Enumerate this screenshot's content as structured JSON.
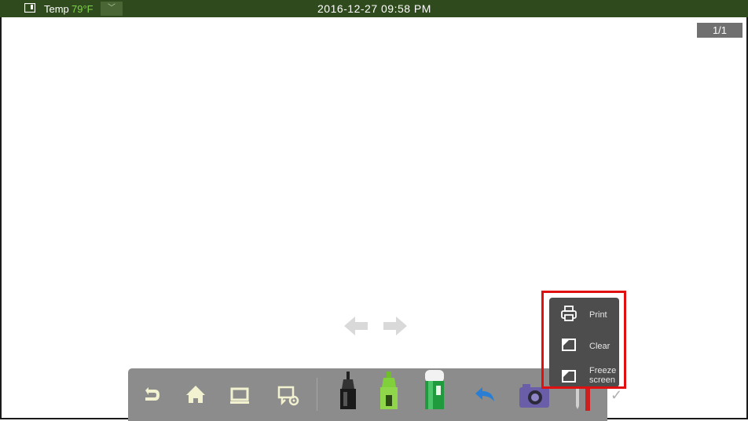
{
  "status_bar": {
    "temp_label": "Temp",
    "temp_value": "79°F",
    "datetime": "2016-12-27 09:58 PM"
  },
  "page_indicator": "1/1",
  "nav": {
    "prev_icon": "arrow-left-icon",
    "next_icon": "arrow-right-icon"
  },
  "toolbar": {
    "items": [
      {
        "name": "back-icon"
      },
      {
        "name": "home-icon"
      },
      {
        "name": "display-icon"
      },
      {
        "name": "screen-settings-icon"
      },
      {
        "name": "black-pen-icon"
      },
      {
        "name": "green-highlighter-icon"
      },
      {
        "name": "eraser-icon"
      },
      {
        "name": "undo-icon"
      },
      {
        "name": "camera-icon"
      },
      {
        "name": "tools-icon"
      }
    ]
  },
  "menu": {
    "items": [
      {
        "label": "Print",
        "icon": "printer-icon"
      },
      {
        "label": "Clear",
        "icon": "clear-icon"
      },
      {
        "label": "Freeze screen",
        "icon": "freeze-icon"
      }
    ]
  },
  "colors": {
    "status_bar": "#2f4a1c",
    "temp_value": "#7fd24a",
    "highlight": "#e01010",
    "toolbar": "#8c8c8c",
    "menu": "#4d4d4d"
  }
}
